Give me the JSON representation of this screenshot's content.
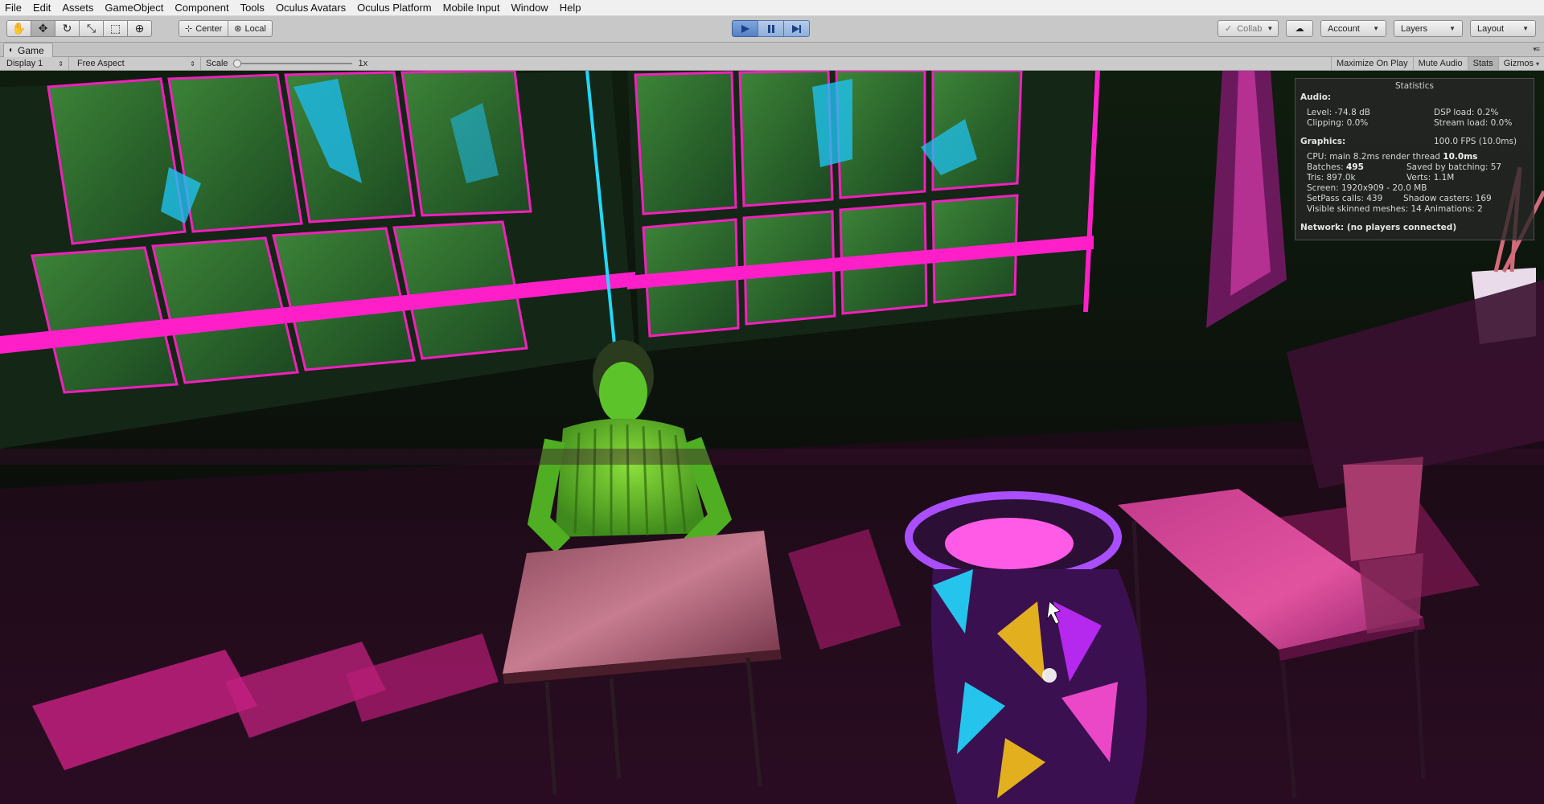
{
  "menu": [
    "File",
    "Edit",
    "Assets",
    "GameObject",
    "Component",
    "Tools",
    "Oculus Avatars",
    "Oculus Platform",
    "Mobile Input",
    "Window",
    "Help"
  ],
  "toolbar": {
    "tools": [
      {
        "name": "hand-tool-button",
        "icon": "hand-icon",
        "glyph": "✋"
      },
      {
        "name": "move-tool-button",
        "icon": "move-icon",
        "glyph": "✥"
      },
      {
        "name": "rotate-tool-button",
        "icon": "rotate-icon",
        "glyph": "↻"
      },
      {
        "name": "scale-tool-button",
        "icon": "scale-icon",
        "glyph": "⤡"
      },
      {
        "name": "rect-tool-button",
        "icon": "rect-icon",
        "glyph": "⬚"
      },
      {
        "name": "transform-tool-button",
        "icon": "transform-icon",
        "glyph": "⊕"
      }
    ],
    "pivot": "Center",
    "space": "Local",
    "collab": "Collab",
    "account": "Account",
    "layers": "Layers",
    "layout": "Layout"
  },
  "window": {
    "tab_title": "Game"
  },
  "game_bar": {
    "display": "Display 1",
    "aspect": "Free Aspect",
    "scale_label": "Scale",
    "scale_value": "1x",
    "maximize_on_play": "Maximize On Play",
    "mute_audio": "Mute Audio",
    "stats": "Stats",
    "gizmos": "Gizmos"
  },
  "statistics": {
    "title": "Statistics",
    "audio_header": "Audio:",
    "level": "Level: -74.8 dB",
    "clipping": "Clipping: 0.0%",
    "dsp_load": "DSP load: 0.2%",
    "stream_load": "Stream load: 0.0%",
    "graphics_header": "Graphics:",
    "fps": "100.0 FPS (10.0ms)",
    "cpu_prefix": "CPU: main 8.2ms  render thread ",
    "cpu_render": "10.0ms",
    "batches_prefix": "Batches: ",
    "batches_value": "495",
    "saved_by_batching": "Saved by batching: 57",
    "tris": "Tris: 897.0k",
    "verts": "Verts: 1.1M",
    "screen": "Screen: 1920x909 - 20.0 MB",
    "setpass": "SetPass calls: 439",
    "shadow_casters": "Shadow casters: 169",
    "visible_skinned": "Visible skinned meshes: 14  Animations: 2",
    "network": "Network: (no players connected)"
  },
  "colors": {
    "neon_magenta": "#ff1fc8",
    "neon_cyan": "#1fd6ff",
    "glass_green": "#2f7a35",
    "character_green": "#6bd42a",
    "play_blue": "#5580c4"
  }
}
